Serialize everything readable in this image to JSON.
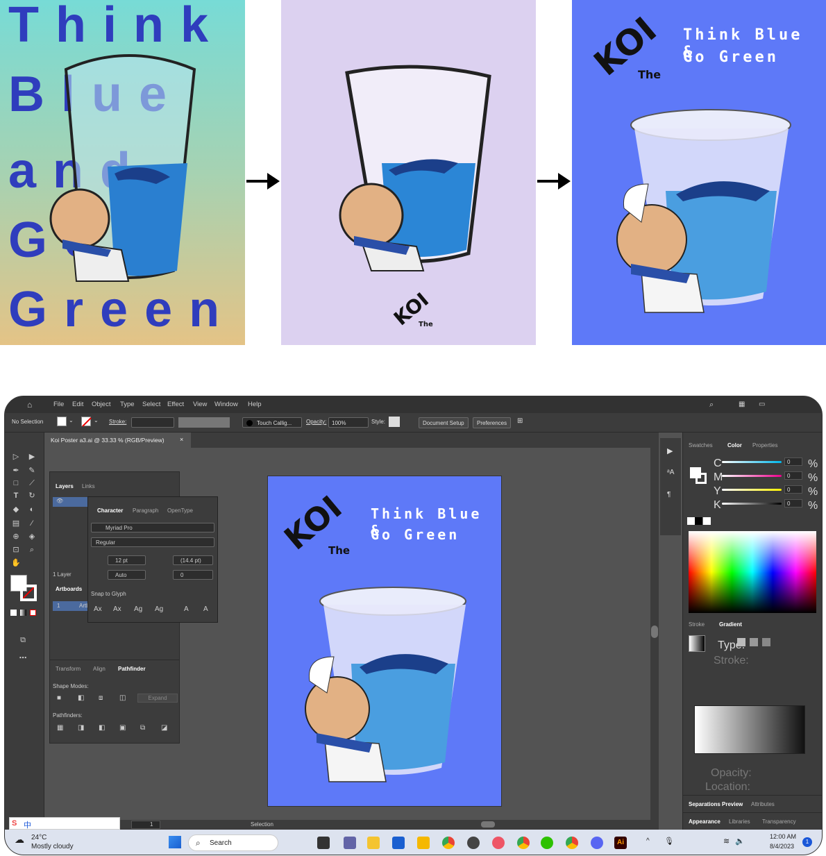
{
  "poster1": {
    "words": [
      "Think",
      "Blue",
      "and",
      "Go",
      "Green"
    ]
  },
  "poster3": {
    "logo": "KOI",
    "logo_sub": "The",
    "slogan_line1": "Think Blue &",
    "slogan_line2": "Go Green"
  },
  "menu": [
    "File",
    "Edit",
    "Object",
    "Type",
    "Select",
    "Effect",
    "View",
    "Window",
    "Help"
  ],
  "control": {
    "selection": "No Selection",
    "stroke_label": "Stroke:",
    "brush": "Touch Callig...",
    "opacity_label": "Opacity:",
    "opacity_value": "100%",
    "style_label": "Style:",
    "document_setup": "Document Setup",
    "preferences": "Preferences"
  },
  "document_tab": "Koi Poster a3.ai @ 33.33 % (RGB/Preview)",
  "layers_panel": {
    "tabs": [
      "Layers",
      "Links"
    ],
    "layer_count": "1 Layer",
    "artboards_tab": "Artboards",
    "artboard_num": "1",
    "artboard_name": "Artb"
  },
  "character_panel": {
    "tabs": [
      "Character",
      "Paragraph",
      "OpenType"
    ],
    "font": "Myriad Pro",
    "style": "Regular",
    "size": "12 pt",
    "leading": "(14.4 pt)",
    "kerning": "Auto",
    "tracking": "0",
    "snap": "Snap to Glyph"
  },
  "pathfinder_panel": {
    "tabs": [
      "Transform",
      "Align",
      "Pathfinder"
    ],
    "shape_modes": "Shape Modes:",
    "expand": "Expand",
    "pathfinders": "Pathfinders:"
  },
  "color_panel": {
    "tabs": [
      "Swatches",
      "Color",
      "Properties"
    ],
    "channels": [
      {
        "label": "C",
        "value": "0",
        "unit": "%",
        "color": "#00b7eb"
      },
      {
        "label": "M",
        "value": "0",
        "unit": "%",
        "color": "#ec008c"
      },
      {
        "label": "Y",
        "value": "0",
        "unit": "%",
        "color": "#fff200"
      },
      {
        "label": "K",
        "value": "0",
        "unit": "%",
        "color": "#000000"
      }
    ]
  },
  "gradient_panel": {
    "tabs": [
      "Stroke",
      "Gradient"
    ],
    "type_label": "Type:",
    "stroke_label": "Stroke:",
    "opacity_label": "Opacity:",
    "location_label": "Location:"
  },
  "bottom_tabs": {
    "row1": [
      "Separations Preview",
      "Attributes"
    ],
    "row2": [
      "Appearance",
      "Libraries",
      "Transparency"
    ]
  },
  "status": {
    "page": "1",
    "tool": "Selection"
  },
  "taskbar": {
    "weather_temp": "24°C",
    "weather_desc": "Mostly cloudy",
    "search": "Search",
    "time": "12:00 AM",
    "date": "8/4/2023",
    "notif": "1"
  }
}
